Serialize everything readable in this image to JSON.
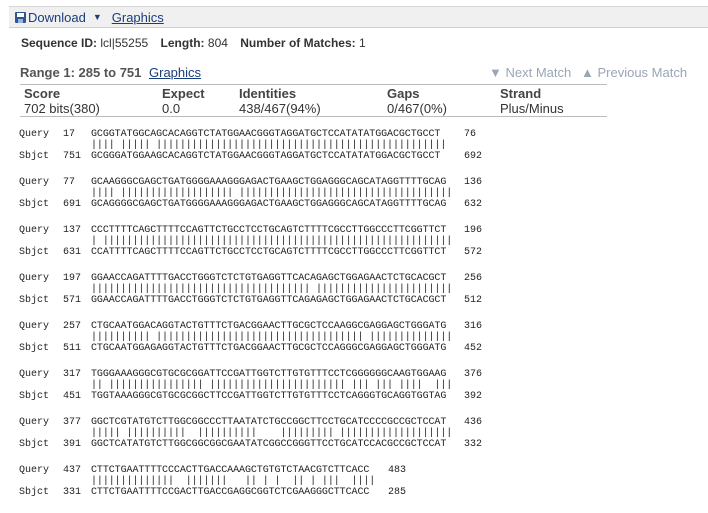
{
  "toolbar": {
    "download_label": "Download",
    "graphics_label": "Graphics"
  },
  "sequence_info": {
    "id_label": "Sequence ID:",
    "id_value": "lcl|55255",
    "length_label": "Length:",
    "length_value": "804",
    "matches_label": "Number of Matches:",
    "matches_value": "1"
  },
  "range": {
    "label": "Range 1: 285 to 751",
    "graphics_label": "Graphics"
  },
  "nav": {
    "next": "▼ Next Match",
    "prev": "▲ Previous Match"
  },
  "stats": {
    "score_label": "Score",
    "score_value": "702 bits(380)",
    "expect_label": "Expect",
    "expect_value": "0.0",
    "identities_label": "Identities",
    "identities_value": "438/467(94%)",
    "gaps_label": "Gaps",
    "gaps_value": "0/467(0%)",
    "strand_label": "Strand",
    "strand_value": "Plus/Minus"
  },
  "alignment": [
    {
      "q_label": "Query",
      "q_start": "17",
      "q_seq": "GCGGTATGGCAGCACAGGTCTATGGAACGGGTAGGATGCTCCATATATGGACGCTGCCT",
      "q_end": "76",
      "match": "|||| ||||| |||||||||||||||||||||||||||||||||||||||||||||||||",
      "s_label": "Sbjct",
      "s_start": "751",
      "s_seq": "GCGGGATGGAAGCACAGGTCTATGGAACGGGTAGGATGCTCCATATATGGACGCTGCCT",
      "s_end": "692"
    },
    {
      "q_label": "Query",
      "q_start": "77",
      "q_seq": "GCAAGGGCGAGCTGATGGGGAAAGGGAGACTGAAGCTGGAGGGCAGCATAGGTTTTGCAG",
      "q_end": "136",
      "match": "|||| ||||||||||||||||||| ||||||||||||||||||||||||||||||||||||",
      "s_label": "Sbjct",
      "s_start": "691",
      "s_seq": "GCAGGGGCGAGCTGATGGGGAAAGGGAGACTGAAGCTGGAGGGCAGCATAGGTTTTGCAG",
      "s_end": "632"
    },
    {
      "q_label": "Query",
      "q_start": "137",
      "q_seq": "CCCTTTTCAGCTTTTCCAGTTCTGCCTCCTGCAGTCTTTTCGCCTTGGCCCTTCGGTTCT",
      "q_end": "196",
      "match": "| |||||||||||||||||||||||||||||||||||||||||||||||||||||||||||",
      "s_label": "Sbjct",
      "s_start": "631",
      "s_seq": "CCATTTTCAGCTTTTCCAGTTCTGCCTCCTGCAGTCTTTTCGCCTTGGCCCTTCGGTTCT",
      "s_end": "572"
    },
    {
      "q_label": "Query",
      "q_start": "197",
      "q_seq": "GGAACCAGATTTTGACCTGGGTCTCTGTGAGGTTCACAGAGCTGGAGAACTCTGCACGCT",
      "q_end": "256",
      "match": "||||||||||||||||||||||||||||||||||||| |||||||||||||||||||||||",
      "s_label": "Sbjct",
      "s_start": "571",
      "s_seq": "GGAACCAGATTTTGACCTGGGTCTCTGTGAGGTTCAGAGAGCTGGAGAACTCTGCACGCT",
      "s_end": "512"
    },
    {
      "q_label": "Query",
      "q_start": "257",
      "q_seq": "CTGCAATGGACAGGTACTGTTTCTGACGGAACTTGCGCTCCAAGGCGAGGAGCTGGGATG",
      "q_end": "316",
      "match": "|||||||||| ||||||||||||||||||||||||||||||||||| ||||||||||||||",
      "s_label": "Sbjct",
      "s_start": "511",
      "s_seq": "CTGCAATGGAGAGGTACTGTTTCTGACGGAACTTGCGCTCCAGGGCGAGGAGCTGGGATG",
      "s_end": "452"
    },
    {
      "q_label": "Query",
      "q_start": "317",
      "q_seq": "TGGGAAAGGGCGTGCGCGGATTCCGATTGGTCTTGTGTTTCCTCGGGGGGCAAGTGGAAG",
      "q_end": "376",
      "match": "|| |||||||||||||||| ||||||||||||||||||||||| ||| ||| ||||  |||",
      "s_label": "Sbjct",
      "s_start": "451",
      "s_seq": "TGGTAAAGGGCGTGCGCGGCTTCCGATTGGTCTTGTGTTTCCTCAGGGTGCAGGTGGTAG",
      "s_end": "392"
    },
    {
      "q_label": "Query",
      "q_start": "377",
      "q_seq": "GGCTCGTATGTCTTGGCGGCCCTTAATATCTGCCGGCTTCCTGCATCCCCGCCGCTCCAT",
      "q_end": "436",
      "match": "||||| ||||||||||  ||||||||||    ||||||||| |||||||||||||||||||",
      "s_label": "Sbjct",
      "s_start": "391",
      "s_seq": "GGCTCATATGTCTTGGCGGCGGCGAATATCGGCCGGGTTCCTGCATCCACGCCGCTCCAT",
      "s_end": "332"
    },
    {
      "q_label": "Query",
      "q_start": "437",
      "q_seq": "CTTCTGAATTTTCCCACTTGACCAAAGCTGTGTCTAACGTCTTCACC",
      "q_end": "483",
      "match": "||||||||||||||  |||||||   || | |  || | |||  ||||",
      "s_label": "Sbjct",
      "s_start": "331",
      "s_seq": "CTTCTGAATTTTCCGACTTGACCGAGGCGGTCTCGAAGGGCTTCACC",
      "s_end": "285"
    }
  ]
}
